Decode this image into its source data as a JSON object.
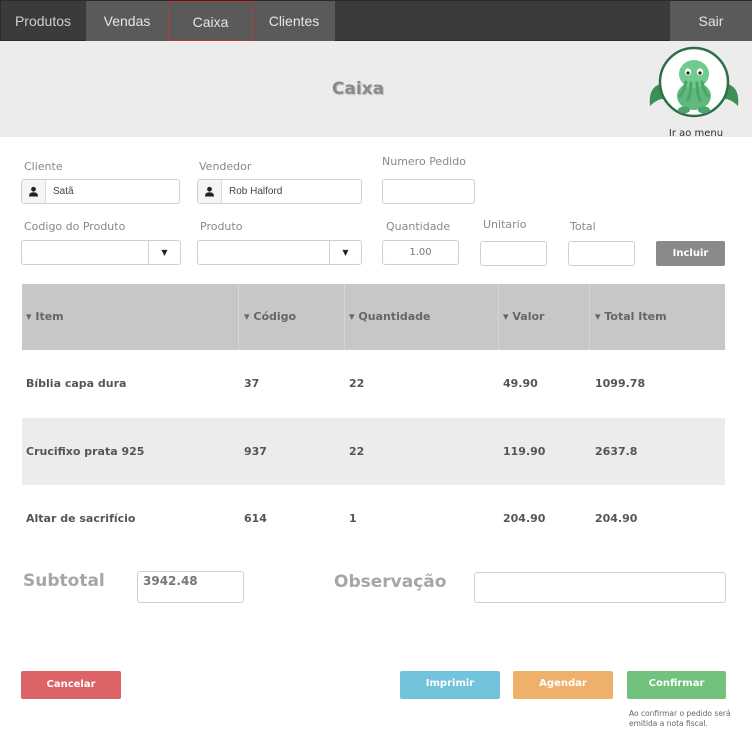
{
  "nav": {
    "tabs": [
      {
        "label": "Produtos"
      },
      {
        "label": "Vendas"
      },
      {
        "label": "Caixa"
      },
      {
        "label": "Clientes"
      }
    ],
    "logout_label": "Sair"
  },
  "header": {
    "title": "Caixa",
    "menu_link": "Ir ao menu"
  },
  "form": {
    "cliente": {
      "label": "Cliente",
      "value": "Satã",
      "icon": "user-icon"
    },
    "vendedor": {
      "label": "Vendedor",
      "value": "Rob Halford",
      "icon": "user-icon"
    },
    "numero_pedido": {
      "label": "Numero Pedido",
      "value": ""
    },
    "codigo_produto": {
      "label": "Codigo do Produto",
      "value": ""
    },
    "produto": {
      "label": "Produto",
      "value": ""
    },
    "quantidade": {
      "label": "Quantidade",
      "value": "1.00"
    },
    "unitario": {
      "label": "Unitario",
      "value": ""
    },
    "total": {
      "label": "Total",
      "value": ""
    },
    "incluir_label": "Incluir",
    "dropdown_glyph": "▼"
  },
  "table": {
    "sort_glyph": "▾",
    "columns": [
      "Item",
      "Código",
      "Quantidade",
      "Valor",
      "Total Item"
    ],
    "rows": [
      {
        "item": "Bíblia capa dura",
        "codigo": "37",
        "quantidade": "22",
        "valor": "49.90",
        "total": "1099.78"
      },
      {
        "item": "Crucifixo prata 925",
        "codigo": "937",
        "quantidade": "22",
        "valor": "119.90",
        "total": "2637.8"
      },
      {
        "item": "Altar de sacrifício",
        "codigo": "614",
        "quantidade": "1",
        "valor": "204.90",
        "total": "204.90"
      }
    ]
  },
  "summary": {
    "subtotal_label": "Subtotal",
    "subtotal_value": "3942.48",
    "observacao_label": "Observação",
    "observacao_value": ""
  },
  "actions": {
    "cancelar": "Cancelar",
    "imprimir": "Imprimir",
    "agendar": "Agendar",
    "confirmar": "Confirmar",
    "confirm_note": "Ao confirmar o pedido será emitida a nota fiscal."
  },
  "colors": {
    "nav_bg": "#3b3b3b",
    "cancel": "#dd6466",
    "print": "#72c4dd",
    "schedule": "#eeb06a",
    "confirm": "#72c17c",
    "incluir": "#8a8a8a"
  }
}
